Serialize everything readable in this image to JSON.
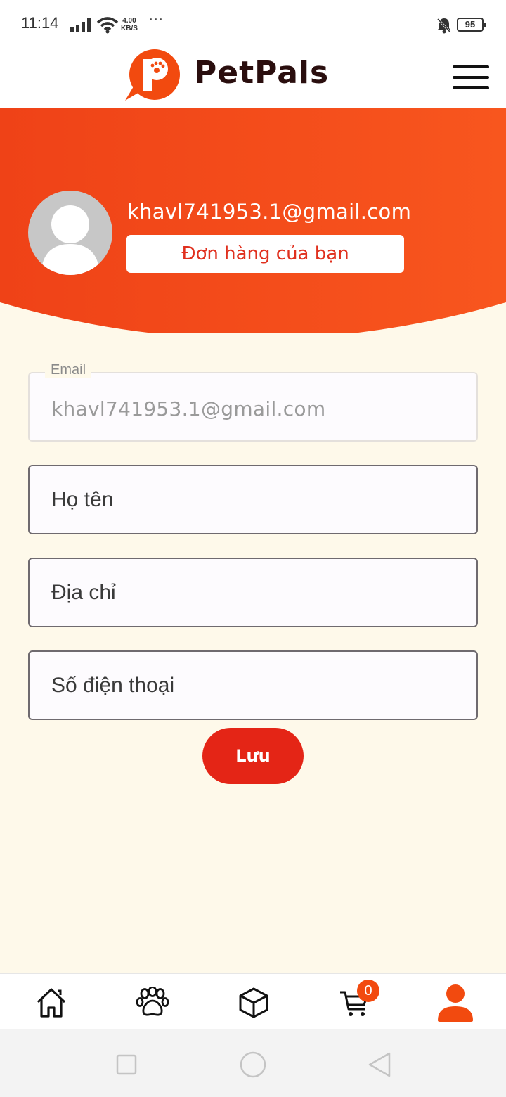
{
  "status_bar": {
    "time": "11:14",
    "net_speed_value": "4.00",
    "net_speed_unit": "KB/S",
    "more": "···",
    "battery_level": "95",
    "icons": [
      "signal-icon",
      "wifi-icon",
      "bell-muted-icon",
      "battery-icon"
    ]
  },
  "header": {
    "brand": "PetPals",
    "logo_letter": "P",
    "menu_icon": "hamburger-icon"
  },
  "profile": {
    "email": "khavl741953.1@gmail.com",
    "orders_button": "Đơn hàng của bạn",
    "avatar_icon": "user-avatar-icon"
  },
  "form": {
    "email_label": "Email",
    "email_value": "khavl741953.1@gmail.com",
    "name_placeholder": "Họ tên",
    "address_placeholder": "Địa chỉ",
    "phone_placeholder": "Số điện thoại",
    "save_label": "Lưu"
  },
  "bottom_nav": {
    "items": [
      {
        "icon": "home-icon"
      },
      {
        "icon": "paw-icon"
      },
      {
        "icon": "box-icon"
      },
      {
        "icon": "cart-icon"
      },
      {
        "icon": "profile-icon"
      }
    ],
    "cart_count": "0",
    "active_index": 4
  },
  "colors": {
    "accent": "#F24A0F",
    "hero_start": "#EF4217",
    "hero_end": "#F8561E",
    "background": "#FEF9EA",
    "save_button": "#E42516"
  }
}
